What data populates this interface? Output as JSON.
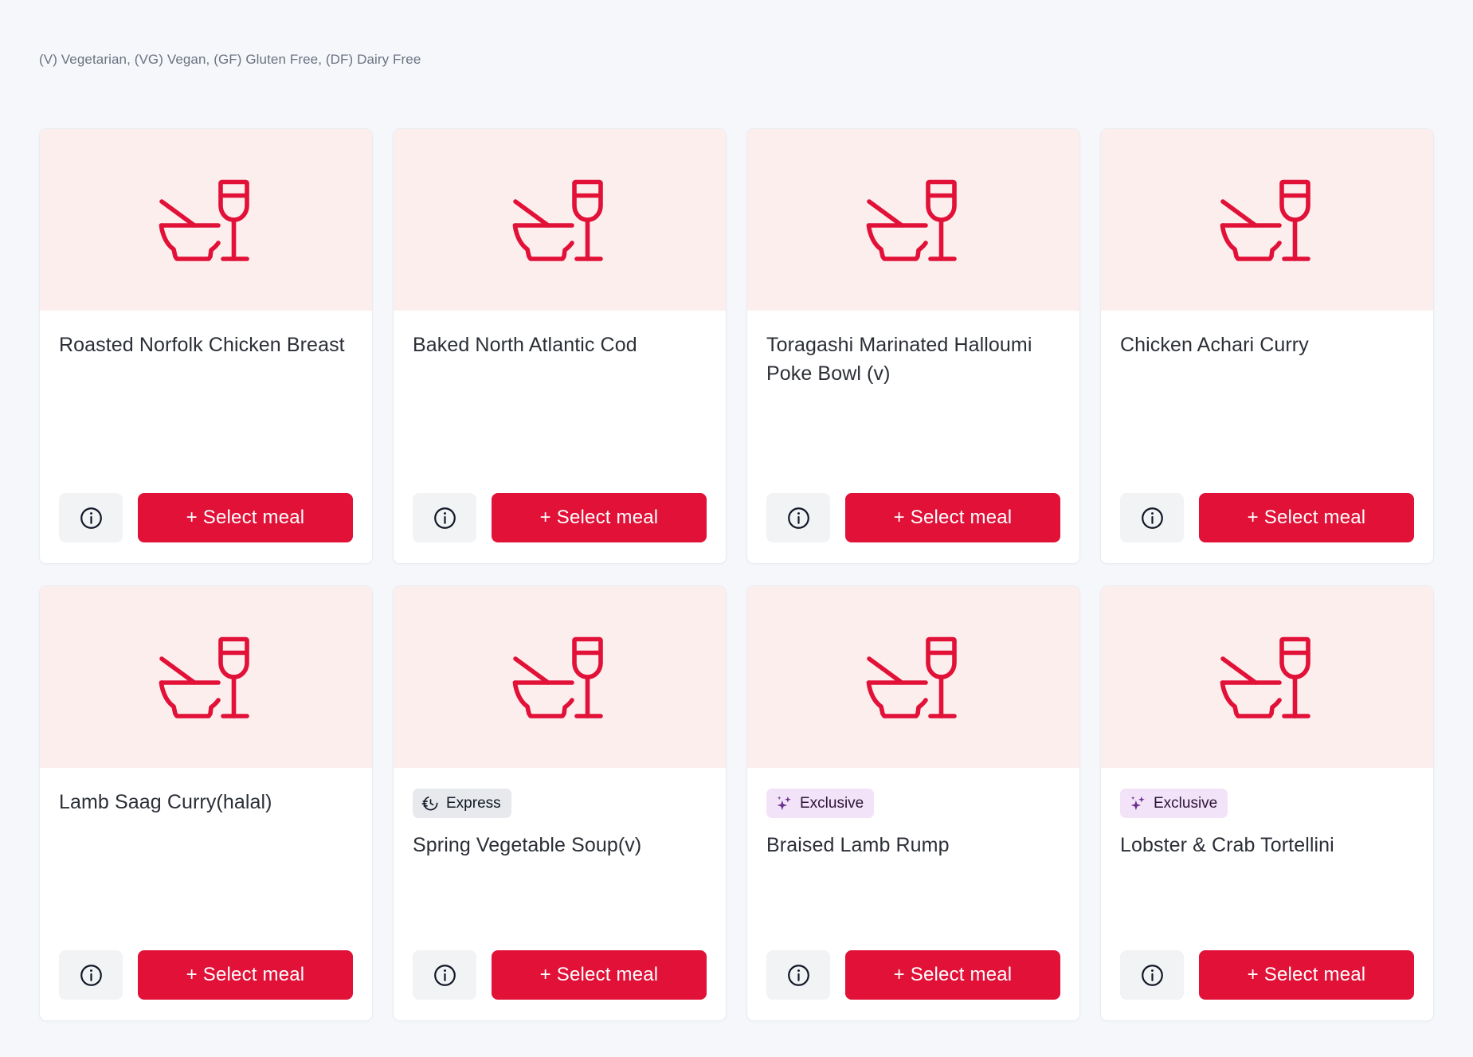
{
  "disclaimer": "(V) Vegetarian, (VG) Vegan, (GF) Gluten Free, (DF) Dairy Free",
  "colors": {
    "page_background": "#f5f7fa",
    "card_background": "#ffffff",
    "image_background": "#fdeeee",
    "brand_red": "#e11138",
    "express_badge_background": "#e7e9ec",
    "exclusive_badge_background": "#f3e3f9",
    "exclusive_badge_text": "#2d1436",
    "info_button_background": "#f2f3f5",
    "title_text": "#2b2f36",
    "disclaimer_text": "#6b7280"
  },
  "buttons": {
    "select_meal_label": "+ Select meal",
    "info_icon_name": "info-icon"
  },
  "badges": {
    "express_label": "Express",
    "express_icon_name": "speed-clock-icon",
    "exclusive_label": "Exclusive",
    "exclusive_icon_name": "sparkles-icon"
  },
  "meal_image_icon_name": "bowl-chopsticks-wine-glass-icon",
  "meals": [
    {
      "title": "Roasted Norfolk Chicken Breast",
      "badge": null
    },
    {
      "title": "Baked North Atlantic Cod",
      "badge": null
    },
    {
      "title": "Toragashi Marinated Halloumi Poke Bowl (v)",
      "badge": null
    },
    {
      "title": "Chicken Achari Curry",
      "badge": null
    },
    {
      "title": "Lamb Saag Curry(halal)",
      "badge": null
    },
    {
      "title": "Spring Vegetable Soup(v)",
      "badge": "express"
    },
    {
      "title": "Braised Lamb Rump",
      "badge": "exclusive"
    },
    {
      "title": "Lobster & Crab Tortellini",
      "badge": "exclusive"
    }
  ]
}
